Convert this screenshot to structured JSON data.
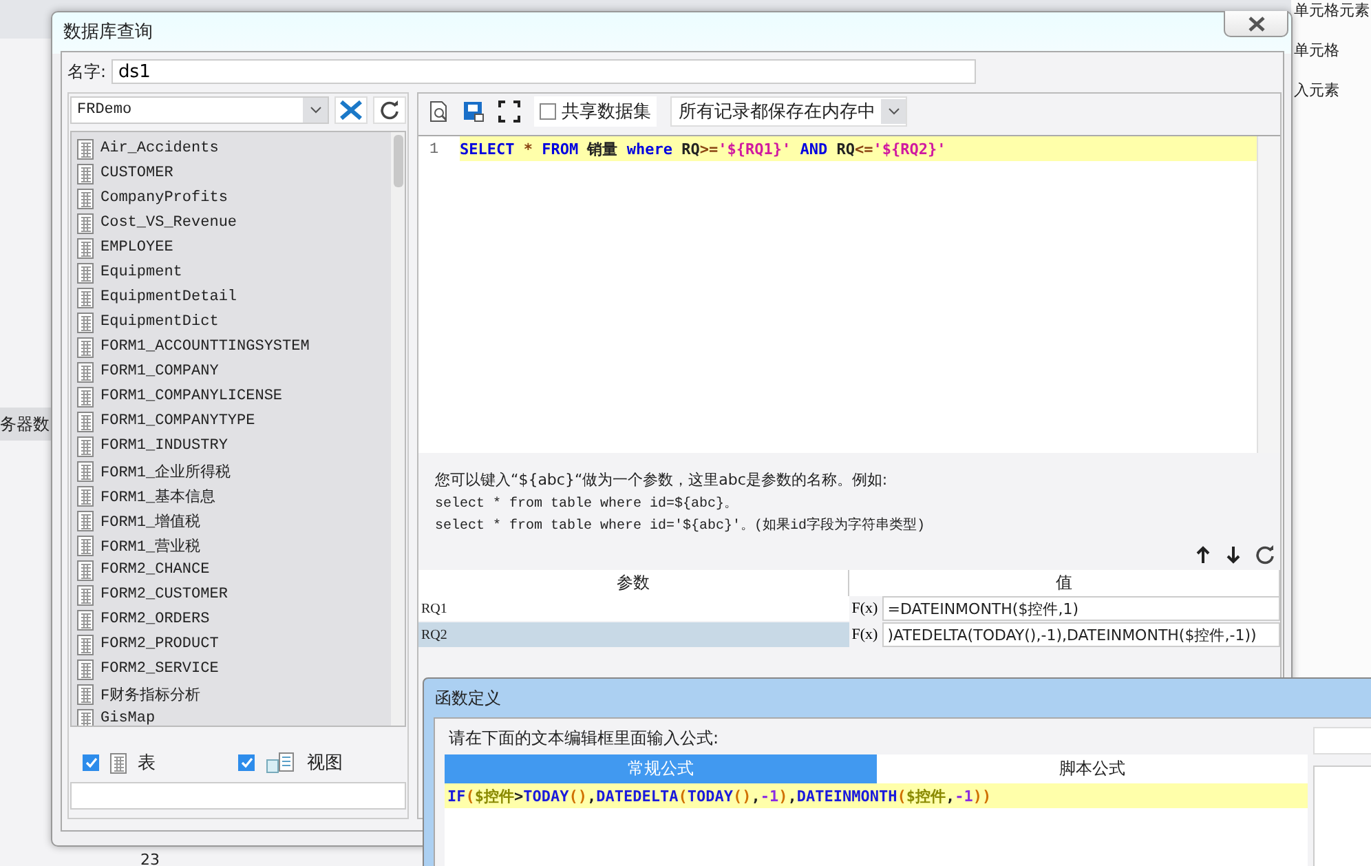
{
  "background": {
    "right_panel": {
      "header": "单元格元素",
      "items": [
        "单元格",
        "入元素"
      ]
    },
    "left_panel": {
      "item": "务器数"
    },
    "row_number": "23"
  },
  "dialog": {
    "title": "数据库查询",
    "name_label": "名字:",
    "name_value": "ds1",
    "datasource": {
      "value": "FRDemo"
    },
    "tables": [
      {
        "label": "Air_Accidents"
      },
      {
        "label": "CUSTOMER"
      },
      {
        "label": "CompanyProfits"
      },
      {
        "label": "Cost_VS_Revenue"
      },
      {
        "label": "EMPLOYEE"
      },
      {
        "label": "Equipment"
      },
      {
        "label": "EquipmentDetail"
      },
      {
        "label": "EquipmentDict"
      },
      {
        "label": "FORM1_ACCOUNTTINGSYSTEM"
      },
      {
        "label": "FORM1_COMPANY"
      },
      {
        "label": "FORM1_COMPANYLICENSE"
      },
      {
        "label": "FORM1_COMPANYTYPE"
      },
      {
        "label": "FORM1_INDUSTRY"
      },
      {
        "label": "FORM1_企业所得税"
      },
      {
        "label": "FORM1_基本信息"
      },
      {
        "label": "FORM1_增值税"
      },
      {
        "label": "FORM1_营业税"
      },
      {
        "label": "FORM2_CHANCE"
      },
      {
        "label": "FORM2_CUSTOMER"
      },
      {
        "label": "FORM2_ORDERS"
      },
      {
        "label": "FORM2_PRODUCT"
      },
      {
        "label": "FORM2_SERVICE"
      },
      {
        "label": "F财务指标分析"
      },
      {
        "label": "GisMap"
      }
    ],
    "filters": [
      {
        "label": "表",
        "checked": true,
        "kind": "table"
      },
      {
        "label": "视图",
        "checked": true,
        "kind": "view"
      }
    ],
    "share_dataset": {
      "label": "共享数据集",
      "checked": false
    },
    "cache_mode": "所有记录都保存在内存中",
    "sql": {
      "line_number": "1",
      "tokens": [
        {
          "kind": "keyword",
          "text": "SELECT"
        },
        {
          "kind": "operator",
          "text": " * "
        },
        {
          "kind": "keyword",
          "text": "FROM"
        },
        {
          "kind": "plain",
          "text": " 销量 "
        },
        {
          "kind": "keyword",
          "text": "where"
        },
        {
          "kind": "plain",
          "text": " RQ"
        },
        {
          "kind": "operator",
          "text": ">="
        },
        {
          "kind": "string",
          "text": "'${RQ1}'"
        },
        {
          "kind": "keyword",
          "text": " AND"
        },
        {
          "kind": "plain",
          "text": " RQ"
        },
        {
          "kind": "operator",
          "text": "<="
        },
        {
          "kind": "string",
          "text": "'${RQ2}'"
        }
      ]
    },
    "help": [
      "您可以键入“${abc}“做为一个参数，这里abc是参数的名称。例如:",
      "select * from table where id=${abc}。",
      "select * from table where id='${abc}'。(如果id字段为字符串类型)"
    ],
    "params": {
      "columns": [
        "参数",
        "值"
      ],
      "rows": [
        {
          "name": "RQ1",
          "fx": "F(x)",
          "value": "=DATEINMONTH($控件,1)",
          "selected": false
        },
        {
          "name": "RQ2",
          "fx": "F(x)",
          "value": ")ATEDELTA(TODAY(),-1),DATEINMONTH($控件,-1))",
          "selected": true
        }
      ]
    }
  },
  "formula_dialog": {
    "title": "函数定义",
    "prompt": "请在下面的文本编辑框里面输入公式:",
    "tabs": [
      {
        "label": "常规公式",
        "selected": true
      },
      {
        "label": "脚本公式",
        "selected": false
      }
    ],
    "tokens": [
      {
        "kind": "function",
        "text": "IF"
      },
      {
        "kind": "paren",
        "text": "("
      },
      {
        "kind": "variable",
        "text": "$控件"
      },
      {
        "kind": "operator",
        "text": ">"
      },
      {
        "kind": "function",
        "text": "TODAY"
      },
      {
        "kind": "paren",
        "text": "()"
      },
      {
        "kind": "operator",
        "text": ","
      },
      {
        "kind": "function",
        "text": "DATEDELTA"
      },
      {
        "kind": "paren",
        "text": "("
      },
      {
        "kind": "function",
        "text": "TODAY"
      },
      {
        "kind": "paren",
        "text": "()"
      },
      {
        "kind": "operator",
        "text": ","
      },
      {
        "kind": "number",
        "text": "-1"
      },
      {
        "kind": "paren",
        "text": ")"
      },
      {
        "kind": "operator",
        "text": ","
      },
      {
        "kind": "function",
        "text": "DATEINMONTH"
      },
      {
        "kind": "paren",
        "text": "("
      },
      {
        "kind": "variable",
        "text": "$控件"
      },
      {
        "kind": "operator",
        "text": ","
      },
      {
        "kind": "number",
        "text": "-1"
      },
      {
        "kind": "paren",
        "text": "))"
      }
    ]
  }
}
